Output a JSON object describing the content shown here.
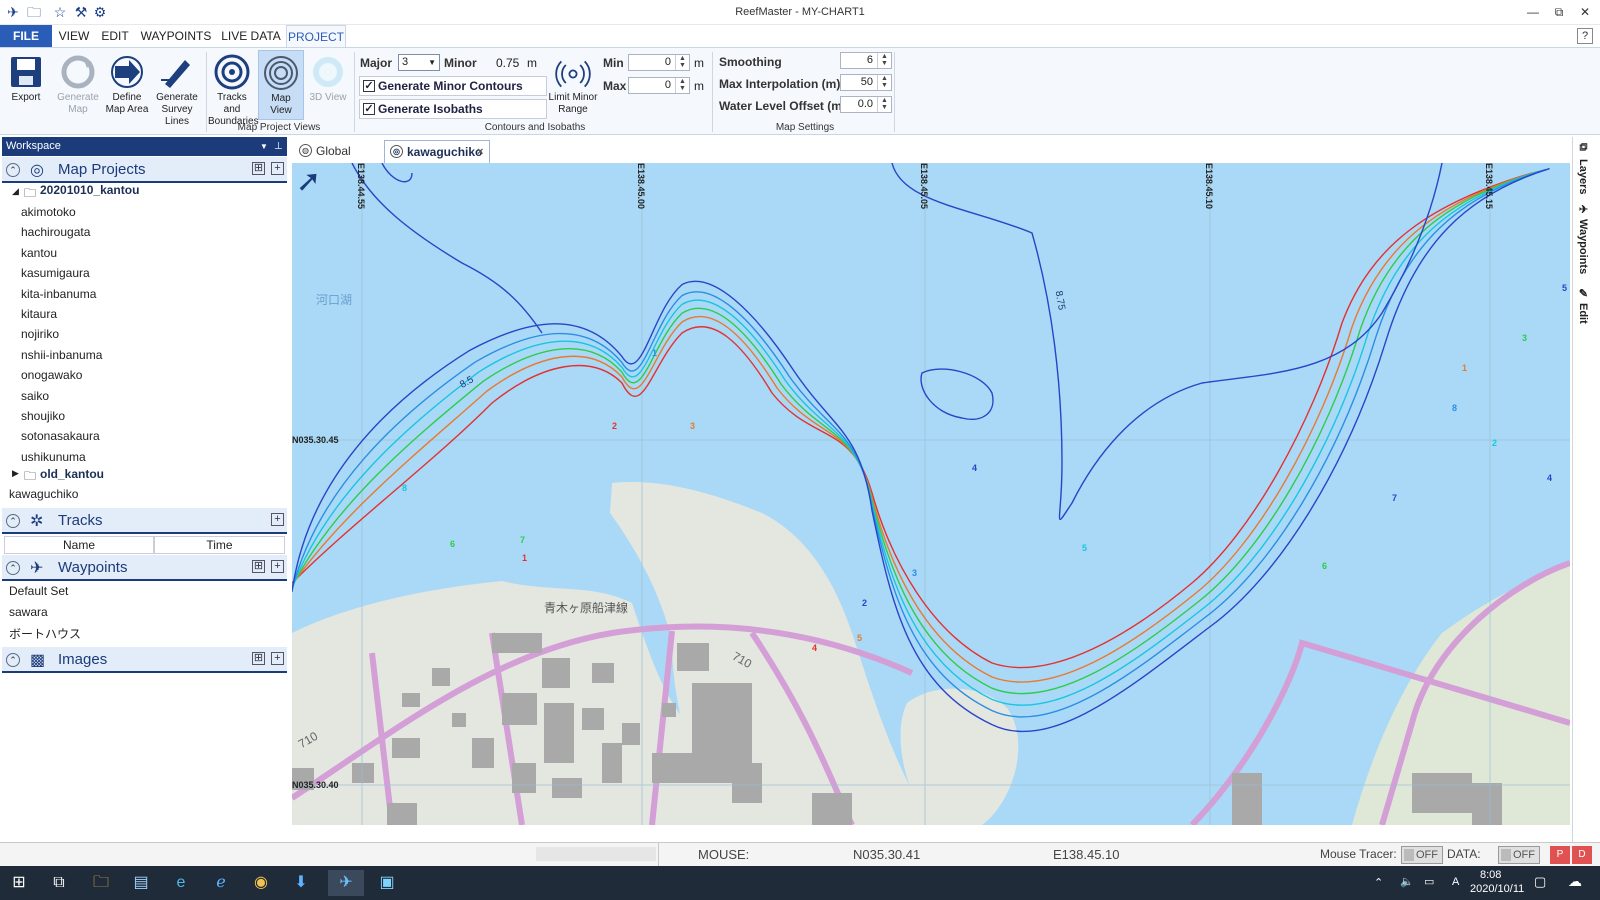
{
  "window": {
    "title": "ReefMaster - MY-CHART1",
    "controls": [
      "—",
      "⧉",
      "✕"
    ]
  },
  "menu": [
    "FILE",
    "VIEW",
    "EDIT",
    "WAYPOINTS",
    "LIVE DATA",
    "PROJECT"
  ],
  "ribbon": {
    "buttons": [
      {
        "l1": "Export",
        "l2": ""
      },
      {
        "l1": "Generate",
        "l2": "Map"
      },
      {
        "l1": "Define",
        "l2": "Map Area"
      },
      {
        "l1": "Generate",
        "l2": "Survey Lines"
      },
      {
        "l1": "Tracks and",
        "l2": "Boundaries"
      },
      {
        "l1": "Map",
        "l2": "View"
      },
      {
        "l1": "3D View",
        "l2": ""
      }
    ],
    "group_views": "Map Project Views",
    "major_label": "Major",
    "major_value": "3",
    "minor_label": "Minor",
    "minor_value": "0.75",
    "unit_m": "m",
    "gen_minor": "Generate Minor Contours",
    "gen_isobaths": "Generate Isobaths",
    "limit_l1": "Limit Minor",
    "limit_l2": "Range",
    "min_label": "Min",
    "min_value": "0",
    "max_label": "Max",
    "max_value": "0",
    "group_contours": "Contours and Isobaths",
    "smoothing_label": "Smoothing",
    "smoothing_value": "6",
    "maxinterp_label": "Max Interpolation (m)",
    "maxinterp_value": "50",
    "wlo_label": "Water Level Offset (m)",
    "wlo_value": "0.0",
    "group_map": "Map Settings",
    "help": "?"
  },
  "workspace": {
    "title": "Workspace",
    "map_projects": "Map Projects",
    "folder": "20201010_kantou",
    "projects": [
      "akimotoko",
      "hachirougata",
      "kantou",
      "kasumigaura",
      "kita-inbanuma",
      "kitaura",
      "nojiriko",
      "nshii-inbanuma",
      "onogawako",
      "saiko",
      "shoujiko",
      "sotonasakaura",
      "ushikunuma"
    ],
    "old_folder": "old_kantou",
    "loose": "kawaguchiko",
    "tracks": "Tracks",
    "col_name": "Name",
    "col_time": "Time",
    "waypoints": "Waypoints",
    "wp_items": [
      "Default Set",
      "sawara",
      "ボートハウス"
    ],
    "images": "Images"
  },
  "tabs": {
    "global": "Global View",
    "current": "kawaguchiko",
    "close": "×"
  },
  "map": {
    "lon_labels": [
      "E138.44.55",
      "E138.45.00",
      "E138.45.05",
      "E138.45.10",
      "E138.45.15"
    ],
    "lat_labels": [
      "N035.30.45",
      "N035.30.40"
    ],
    "lake_label": "河口湖",
    "road_label": "青木ヶ原船津線",
    "route_710": "710",
    "route_710b": "710",
    "depth_875": "8.75",
    "depth_85": "8.5",
    "contour_colors": [
      "#e53030",
      "#e87a2e",
      "#2ecc4a",
      "#18c6e0",
      "#2a8ee6",
      "#2845c8"
    ],
    "contour_labels": [
      "1",
      "2",
      "3",
      "4",
      "5",
      "6",
      "7",
      "8"
    ]
  },
  "sidebar_right": [
    "Layers",
    "Waypoints",
    "Edit"
  ],
  "status": {
    "mouse_label": "MOUSE:",
    "lat": "N035.30.41",
    "lon": "E138.45.10",
    "tracer_label": "Mouse Tracer:",
    "tracer_state": "OFF",
    "data_label": "DATA:",
    "data_state": "OFF"
  },
  "taskbar": {
    "time": "8:08",
    "date": "2020/10/11",
    "ime": "A"
  }
}
